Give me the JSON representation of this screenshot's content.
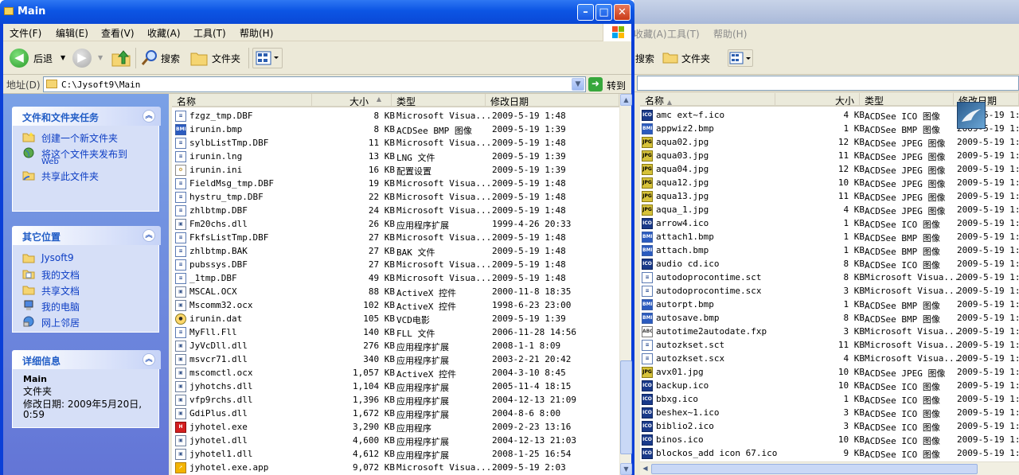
{
  "window": {
    "title": "Main"
  },
  "menu": [
    "文件(F)",
    "编辑(E)",
    "查看(V)",
    "收藏(A)",
    "工具(T)",
    "帮助(H)"
  ],
  "toolbar": {
    "back": "后退",
    "search": "搜索",
    "folders": "文件夹"
  },
  "address": {
    "label": "地址(D)",
    "value": "C:\\Jysoft9\\Main",
    "go": "转到"
  },
  "pane": {
    "tasks": {
      "title": "文件和文件夹任务",
      "items": [
        "创建一个新文件夹",
        "将这个文件夹发布到",
        "Web",
        "共享此文件夹"
      ]
    },
    "places": {
      "title": "其它位置",
      "items": [
        "Jysoft9",
        "我的文档",
        "共享文档",
        "我的电脑",
        "网上邻居"
      ]
    },
    "details": {
      "title": "详细信息",
      "name": "Main",
      "type": "文件夹",
      "modified": "修改日期: 2009年5月20日,",
      "modified2": "0:59"
    }
  },
  "columns": {
    "name": "名称",
    "size": "大小",
    "type": "类型",
    "date": "修改日期"
  },
  "files": [
    {
      "icon": "doc",
      "name": "fzgz_tmp.DBF",
      "size": "8 KB",
      "type": "Microsoft Visua...",
      "date": "2009-5-19 1:48"
    },
    {
      "icon": "bmp",
      "name": "irunin.bmp",
      "size": "8 KB",
      "type": "ACDSee BMP 图像",
      "date": "2009-5-19 1:39"
    },
    {
      "icon": "doc",
      "name": "sylbListTmp.DBF",
      "size": "11 KB",
      "type": "Microsoft Visua...",
      "date": "2009-5-19 1:48"
    },
    {
      "icon": "doc",
      "name": "irunin.lng",
      "size": "13 KB",
      "type": "LNG 文件",
      "date": "2009-5-19 1:39"
    },
    {
      "icon": "cfg",
      "name": "irunin.ini",
      "size": "16 KB",
      "type": "配置设置",
      "date": "2009-5-19 1:39"
    },
    {
      "icon": "doc",
      "name": "FieldMsg_tmp.DBF",
      "size": "19 KB",
      "type": "Microsoft Visua...",
      "date": "2009-5-19 1:48"
    },
    {
      "icon": "doc",
      "name": "hystru_tmp.DBF",
      "size": "22 KB",
      "type": "Microsoft Visua...",
      "date": "2009-5-19 1:48"
    },
    {
      "icon": "doc",
      "name": "zhlbtmp.DBF",
      "size": "24 KB",
      "type": "Microsoft Visua...",
      "date": "2009-5-19 1:48"
    },
    {
      "icon": "dll",
      "name": "Fm20chs.dll",
      "size": "26 KB",
      "type": "应用程序扩展",
      "date": "1999-4-26 20:33"
    },
    {
      "icon": "doc",
      "name": "FkfsListTmp.DBF",
      "size": "27 KB",
      "type": "Microsoft Visua...",
      "date": "2009-5-19 1:48"
    },
    {
      "icon": "doc",
      "name": "zhlbtmp.BAK",
      "size": "27 KB",
      "type": "BAK 文件",
      "date": "2009-5-19 1:48"
    },
    {
      "icon": "doc",
      "name": "pubssys.DBF",
      "size": "27 KB",
      "type": "Microsoft Visua...",
      "date": "2009-5-19 1:48"
    },
    {
      "icon": "doc",
      "name": "_1tmp.DBF",
      "size": "49 KB",
      "type": "Microsoft Visua...",
      "date": "2009-5-19 1:48"
    },
    {
      "icon": "dll",
      "name": "MSCAL.OCX",
      "size": "88 KB",
      "type": "ActiveX 控件",
      "date": "2000-11-8 18:35"
    },
    {
      "icon": "dll",
      "name": "Mscomm32.ocx",
      "size": "102 KB",
      "type": "ActiveX 控件",
      "date": "1998-6-23 23:00"
    },
    {
      "icon": "dat",
      "name": "irunin.dat",
      "size": "105 KB",
      "type": "VCD电影",
      "date": "2009-5-19 1:39"
    },
    {
      "icon": "doc",
      "name": "MyFll.Fll",
      "size": "140 KB",
      "type": "FLL 文件",
      "date": "2006-11-28 14:56"
    },
    {
      "icon": "dll",
      "name": "JyVcDll.dll",
      "size": "276 KB",
      "type": "应用程序扩展",
      "date": "2008-1-1 8:09"
    },
    {
      "icon": "dll",
      "name": "msvcr71.dll",
      "size": "340 KB",
      "type": "应用程序扩展",
      "date": "2003-2-21 20:42"
    },
    {
      "icon": "dll",
      "name": "mscomctl.ocx",
      "size": "1,057 KB",
      "type": "ActiveX 控件",
      "date": "2004-3-10 8:45"
    },
    {
      "icon": "dll",
      "name": "jyhotchs.dll",
      "size": "1,104 KB",
      "type": "应用程序扩展",
      "date": "2005-11-4 18:15"
    },
    {
      "icon": "dll",
      "name": "vfp9rchs.dll",
      "size": "1,396 KB",
      "type": "应用程序扩展",
      "date": "2004-12-13 21:09"
    },
    {
      "icon": "dll",
      "name": "GdiPlus.dll",
      "size": "1,672 KB",
      "type": "应用程序扩展",
      "date": "2004-8-6 8:00"
    },
    {
      "icon": "exe",
      "name": "jyhotel.exe",
      "size": "3,290 KB",
      "type": "应用程序",
      "date": "2009-2-23 13:16"
    },
    {
      "icon": "dll",
      "name": "jyhotel.dll",
      "size": "4,600 KB",
      "type": "应用程序扩展",
      "date": "2004-12-13 21:03"
    },
    {
      "icon": "dll",
      "name": "jyhotel1.dll",
      "size": "4,612 KB",
      "type": "应用程序扩展",
      "date": "2008-1-25 16:54"
    },
    {
      "icon": "app",
      "name": "jyhotel.exe.app",
      "size": "9,072 KB",
      "type": "Microsoft Visua...",
      "date": "2009-5-19 2:03"
    }
  ],
  "bg": {
    "menu": [
      "收藏(A)",
      "工具(T)",
      "帮助(H)"
    ],
    "toolbar": {
      "search": "搜索",
      "folders": "文件夹"
    },
    "files": [
      {
        "icon": "ico",
        "name": "amc ext~f.ico",
        "size": "4 KB",
        "type": "ACDSee ICO 图像",
        "date": "2009-5-19 1:"
      },
      {
        "icon": "bmp",
        "name": "appwiz2.bmp",
        "size": "1 KB",
        "type": "ACDSee BMP 图像",
        "date": "2009-5-19 1:"
      },
      {
        "icon": "jpg",
        "name": "aqua02.jpg",
        "size": "12 KB",
        "type": "ACDSee JPEG 图像",
        "date": "2009-5-19 1:"
      },
      {
        "icon": "jpg",
        "name": "aqua03.jpg",
        "size": "11 KB",
        "type": "ACDSee JPEG 图像",
        "date": "2009-5-19 1:"
      },
      {
        "icon": "jpg",
        "name": "aqua04.jpg",
        "size": "12 KB",
        "type": "ACDSee JPEG 图像",
        "date": "2009-5-19 1:"
      },
      {
        "icon": "jpg",
        "name": "aqua12.jpg",
        "size": "10 KB",
        "type": "ACDSee JPEG 图像",
        "date": "2009-5-19 1:"
      },
      {
        "icon": "jpg",
        "name": "aqua13.jpg",
        "size": "11 KB",
        "type": "ACDSee JPEG 图像",
        "date": "2009-5-19 1:"
      },
      {
        "icon": "jpg",
        "name": "aqua_1.jpg",
        "size": "4 KB",
        "type": "ACDSee JPEG 图像",
        "date": "2009-5-19 1:"
      },
      {
        "icon": "ico",
        "name": "arrow4.ico",
        "size": "1 KB",
        "type": "ACDSee ICO 图像",
        "date": "2009-5-19 1:"
      },
      {
        "icon": "bmp",
        "name": "attach1.bmp",
        "size": "1 KB",
        "type": "ACDSee BMP 图像",
        "date": "2009-5-19 1:"
      },
      {
        "icon": "bmp",
        "name": "attach.bmp",
        "size": "1 KB",
        "type": "ACDSee BMP 图像",
        "date": "2009-5-19 1:"
      },
      {
        "icon": "ico",
        "name": "audio cd.ico",
        "size": "8 KB",
        "type": "ACDSee ICO 图像",
        "date": "2009-5-19 1:"
      },
      {
        "icon": "doc",
        "name": "autodoprocontime.sct",
        "size": "8 KB",
        "type": "Microsoft Visua...",
        "date": "2009-5-19 1:"
      },
      {
        "icon": "doc",
        "name": "autodoprocontime.scx",
        "size": "3 KB",
        "type": "Microsoft Visua...",
        "date": "2009-5-19 1:"
      },
      {
        "icon": "bmp",
        "name": "autorpt.bmp",
        "size": "1 KB",
        "type": "ACDSee BMP 图像",
        "date": "2009-5-19 1:"
      },
      {
        "icon": "bmp",
        "name": "autosave.bmp",
        "size": "8 KB",
        "type": "ACDSee BMP 图像",
        "date": "2009-5-19 1:"
      },
      {
        "icon": "abc",
        "name": "autotime2autodate.fxp",
        "size": "3 KB",
        "type": "Microsoft Visua...",
        "date": "2009-5-19 1:"
      },
      {
        "icon": "doc",
        "name": "autozkset.sct",
        "size": "11 KB",
        "type": "Microsoft Visua...",
        "date": "2009-5-19 1:"
      },
      {
        "icon": "doc",
        "name": "autozkset.scx",
        "size": "4 KB",
        "type": "Microsoft Visua...",
        "date": "2009-5-19 1:"
      },
      {
        "icon": "jpg",
        "name": "avx01.jpg",
        "size": "10 KB",
        "type": "ACDSee JPEG 图像",
        "date": "2009-5-19 1:"
      },
      {
        "icon": "ico",
        "name": "backup.ico",
        "size": "10 KB",
        "type": "ACDSee ICO 图像",
        "date": "2009-5-19 1:"
      },
      {
        "icon": "ico",
        "name": "bbxg.ico",
        "size": "1 KB",
        "type": "ACDSee ICO 图像",
        "date": "2009-5-19 1:"
      },
      {
        "icon": "ico",
        "name": "beshex~1.ico",
        "size": "3 KB",
        "type": "ACDSee ICO 图像",
        "date": "2009-5-19 1:"
      },
      {
        "icon": "ico",
        "name": "biblio2.ico",
        "size": "3 KB",
        "type": "ACDSee ICO 图像",
        "date": "2009-5-19 1:"
      },
      {
        "icon": "ico",
        "name": "binos.ico",
        "size": "10 KB",
        "type": "ACDSee ICO 图像",
        "date": "2009-5-19 1:"
      },
      {
        "icon": "ico",
        "name": "blockos_add icon 67.ico",
        "size": "9 KB",
        "type": "ACDSee ICO 图像",
        "date": "2009-5-19 1:"
      }
    ]
  }
}
